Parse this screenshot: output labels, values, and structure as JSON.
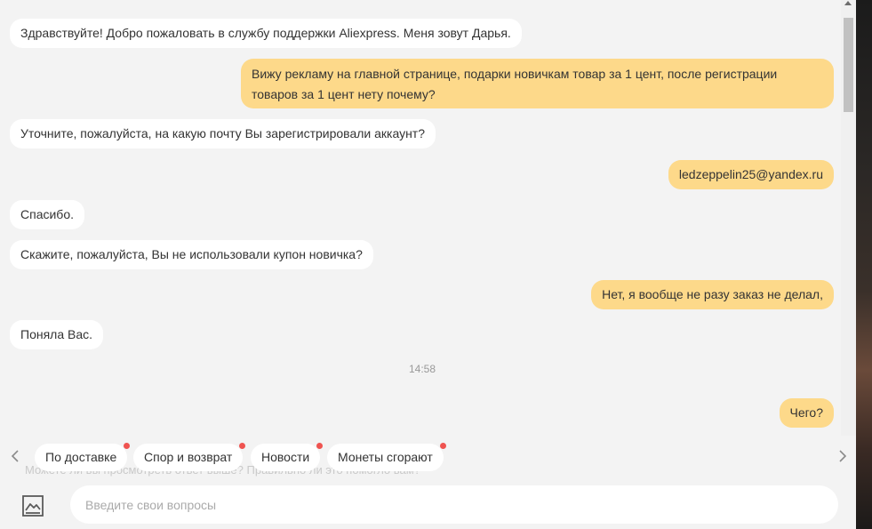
{
  "messages": [
    {
      "side": "in",
      "text": "Здравствуйте! Добро пожаловать в службу поддержки Aliexpress. Меня зовут Дарья."
    },
    {
      "side": "out",
      "text": "Вижу рекламу на главной странице, подарки новичкам товар за 1 цент, после регистрации товаров за 1 цент нету почему?"
    },
    {
      "side": "in",
      "text": "Уточните, пожалуйста, на какую почту Вы зарегистрировали аккаунт?"
    },
    {
      "side": "out",
      "text": "ledzeppelin25@yandex.ru"
    },
    {
      "side": "in",
      "text": "Спасибо."
    },
    {
      "side": "in",
      "text": "Скажите, пожалуйста, Вы не использовали купон новичка?"
    },
    {
      "side": "out",
      "text": "Нет, я вообще не разу заказ не делал,"
    },
    {
      "side": "in",
      "text": "Поняла Вас."
    },
    {
      "side": "out",
      "text": "Чего?"
    }
  ],
  "timestamp": "14:58",
  "quick_replies": {
    "faded_hint": "Можете ли вы просмотреть ответ выше? Правильно ли это помогло вам?",
    "chips": [
      "По доставке",
      "Спор и возврат",
      "Новости",
      "Монеты сгорают"
    ]
  },
  "input": {
    "placeholder": "Введите свои вопросы",
    "value": ""
  },
  "icons": {
    "image_upload": "image-upload-icon",
    "prev": "chevron-left-icon",
    "next": "chevron-right-icon"
  },
  "colors": {
    "incoming_bubble": "#ffffff",
    "outgoing_bubble": "#fdd98a",
    "badge": "#ef5350",
    "background": "#f3f3f3"
  }
}
